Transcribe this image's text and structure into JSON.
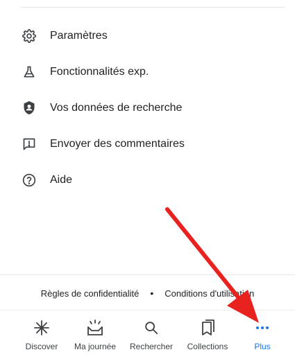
{
  "menu": {
    "items": [
      {
        "label": "Paramètres",
        "icon": "gear-icon"
      },
      {
        "label": "Fonctionnalités exp.",
        "icon": "flask-icon"
      },
      {
        "label": "Vos données de recherche",
        "icon": "shield-user-icon"
      },
      {
        "label": "Envoyer des commentaires",
        "icon": "feedback-icon"
      },
      {
        "label": "Aide",
        "icon": "help-icon"
      }
    ]
  },
  "footer": {
    "privacy": "Règles de confidentialité",
    "separator": "•",
    "terms": "Conditions d'utilisation"
  },
  "bottom_nav": {
    "items": [
      {
        "label": "Discover",
        "icon": "asterisk-icon",
        "active": false
      },
      {
        "label": "Ma journée",
        "icon": "inbox-sun-icon",
        "active": false
      },
      {
        "label": "Rechercher",
        "icon": "search-icon",
        "active": false
      },
      {
        "label": "Collections",
        "icon": "bookmark-icon",
        "active": false
      },
      {
        "label": "Plus",
        "icon": "more-dots-icon",
        "active": true
      }
    ]
  },
  "colors": {
    "active": "#1a73e8",
    "annotation_arrow": "#e8231f",
    "text": "#202124"
  }
}
